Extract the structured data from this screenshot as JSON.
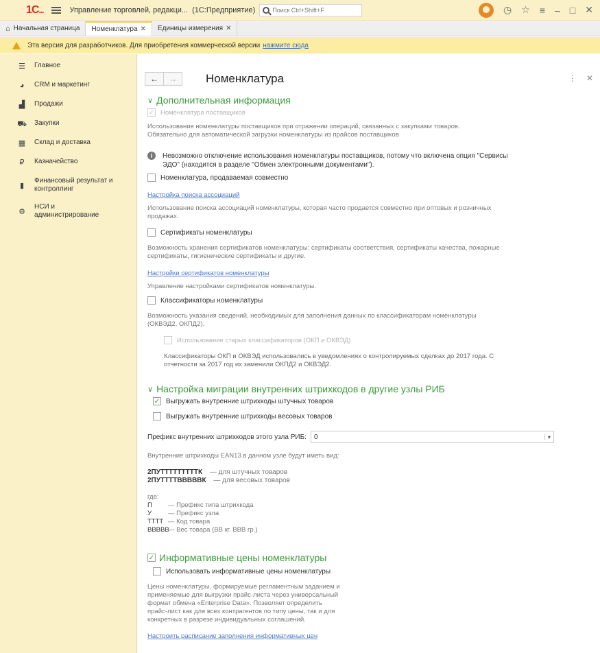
{
  "app": {
    "logo": "1С",
    "title": "Управление торговлей, редакци...",
    "mode": "(1С:Предприятие)",
    "search_placeholder": "Поиск Ctrl+Shift+F"
  },
  "tabs": [
    {
      "label": "Начальная страница"
    },
    {
      "label": "Номенклатура"
    },
    {
      "label": "Единицы измерения"
    }
  ],
  "notice": {
    "text": "Эта версия для разработчиков. Для приобретения коммерческой версии",
    "link": "нажмите сюда"
  },
  "sidebar": {
    "items": [
      {
        "label": "Главное",
        "icon": "menu-icon"
      },
      {
        "label": "CRM и маркетинг",
        "icon": "crm-icon"
      },
      {
        "label": "Продажи",
        "icon": "sales-icon"
      },
      {
        "label": "Закупки",
        "icon": "cart-icon"
      },
      {
        "label": "Склад и доставка",
        "icon": "warehouse-icon"
      },
      {
        "label": "Казначейство",
        "icon": "treasury-icon"
      },
      {
        "label": "Финансовый результат и контроллинг",
        "icon": "finance-icon"
      },
      {
        "label": "НСИ и администрирование",
        "icon": "gear-icon"
      }
    ]
  },
  "page": {
    "title": "Номенклатура",
    "section1": {
      "title": "Дополнительная информация",
      "cb_supplier": "Номенклатура поставщиков",
      "supplier_desc1": "Использование номенклатуры поставщиков при отражении операций, связанных с закупками товаров.",
      "supplier_desc2": "Обязательно для автоматической загрузки номенклатуры из прайсов поставщиков",
      "info1": "Невозможно отключение использования номенклатуры поставщиков, потому что включена опция \"Сервисы",
      "info2": "ЭДО\" (находится в разделе \"Обмен электронными документами\").",
      "cb_sold_together": "Номенклатура, продаваемая совместно",
      "assoc_link": "Настройка поиска ассоциаций",
      "assoc_desc1": "Использование поиска ассоциаций номенклатуры, которая часто продается совместно при оптовых и розничных",
      "assoc_desc2": "продажах.",
      "cb_certs": "Сертификаты номенклатуры",
      "certs_desc1": "Возможность хранения сертификатов номенклатуры: сертификаты соответствия, сертификаты качества, пожарные",
      "certs_desc2": "сертификаты, гигиенические сертификаты и другие.",
      "certs_link": "Настройки сертификатов номенклатуры",
      "certs_manage": "Управление настройками сертификатов номенклатуры.",
      "cb_classifiers": "Классификаторы номенклатуры",
      "class_desc1": "Возможность указания сведений, необходимых для заполнения данных по классификаторам номенклатуры",
      "class_desc2": "(ОКВЭД2, ОКПД2).",
      "cb_old_class": "Использование старых классификаторов (ОКП и ОКВЭД)",
      "old_desc1": "Классификаторы ОКП и ОКВЭД использовались в уведомлениях о контролируемых сделках до 2017 года. С",
      "old_desc2": "отчетности за 2017 год их заменили ОКПД2 и ОКВЭД2."
    },
    "section2": {
      "title": "Настройка миграции внутренних штрихкодов в другие узлы РИБ",
      "cb_piece": "Выгружать внутренние штрихкоды штучных товаров",
      "cb_weight": "Выгружать внутренние штрихкоды весовых товаров",
      "prefix_label": "Префикс внутренних штрихкодов этого узла РИБ:",
      "prefix_value": "0",
      "ean_desc": "Внутренние штрихкоды EAN13 в данном узле будут иметь вид:",
      "code1": "2ПУТТТТТТТТТК",
      "code1_desc": "— для штучных товаров",
      "code2": "2ПУТТТТВВВВВК",
      "code2_desc": "— для весовых товаров",
      "where": "где:",
      "legend": [
        {
          "k": "П",
          "v": "— Префикс типа штрихкода"
        },
        {
          "k": "У",
          "v": "— Префикс узла"
        },
        {
          "k": "ТТТТ",
          "v": "— Код товара"
        },
        {
          "k": "ВВВВВ",
          "v": "— Вес товара (ВВ кг. ВВВ гр.)"
        }
      ]
    },
    "section3": {
      "title": "Информативные цены номенклатуры",
      "cb_use": "Использовать информативные цены номенклатуры",
      "desc1": "Цены номенклатуры, формируемые регламентным заданием и",
      "desc2": "применяемые для выгрузки прайс-листа через универсальный",
      "desc3": "формат обмена «Enterprise Data». Позволяет определить",
      "desc4": "прайс-лист как для всех контрагентов по типу цены, так и для",
      "desc5": "конкретных в разрезе индивидуальных соглашений.",
      "link": "Настроить расписание заполнения информативных цен"
    }
  }
}
